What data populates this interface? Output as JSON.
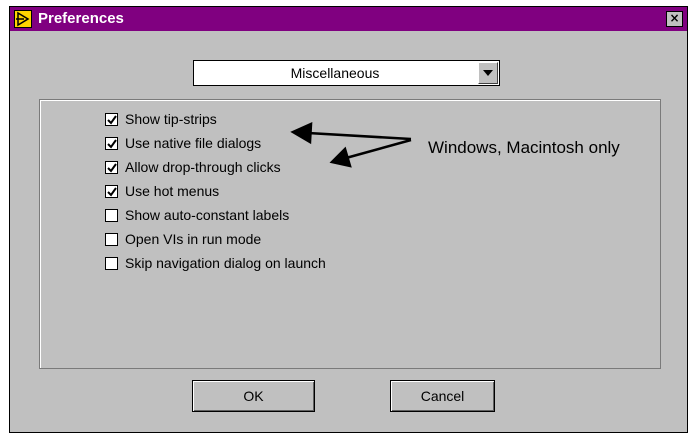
{
  "window": {
    "title": "Preferences",
    "close_glyph": "×"
  },
  "category": {
    "selected": "Miscellaneous"
  },
  "options": [
    {
      "label": "Show tip-strips",
      "checked": true
    },
    {
      "label": "Use native file dialogs",
      "checked": true
    },
    {
      "label": "Allow drop-through clicks",
      "checked": true
    },
    {
      "label": "Use hot menus",
      "checked": true
    },
    {
      "label": "Show auto-constant labels",
      "checked": false
    },
    {
      "label": "Open VIs in run mode",
      "checked": false
    },
    {
      "label": "Skip navigation dialog on launch",
      "checked": false
    }
  ],
  "annotation": {
    "text": "Windows, Macintosh only"
  },
  "buttons": {
    "ok": "OK",
    "cancel": "Cancel"
  },
  "colors": {
    "titlebar": "#800080",
    "face": "#c0c0c0"
  },
  "icons": {
    "app": "labview-arrow-icon",
    "close": "close-icon",
    "dropdown": "chevron-down-icon",
    "check": "checkmark-icon"
  }
}
